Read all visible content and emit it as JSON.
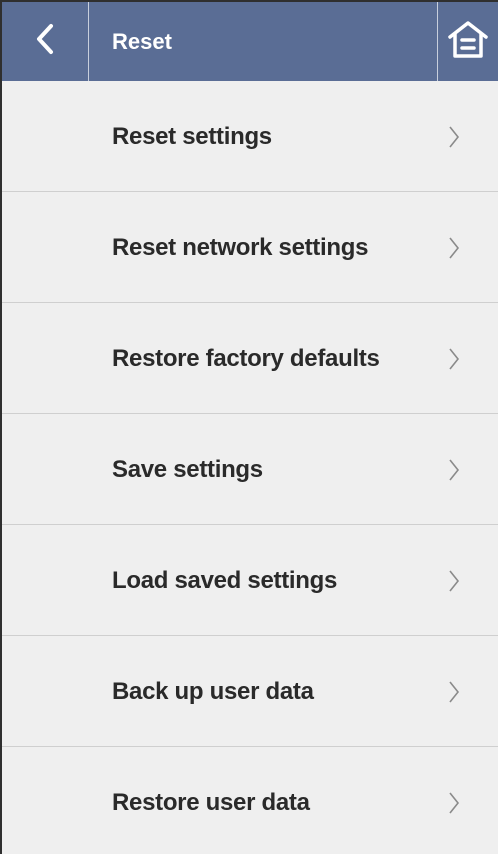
{
  "header": {
    "title": "Reset",
    "back_icon": "chevron-left-icon",
    "home_icon": "home-icon",
    "background_color": "#5a6d95"
  },
  "menu": {
    "items": [
      {
        "label": "Reset settings"
      },
      {
        "label": "Reset network settings"
      },
      {
        "label": "Restore factory defaults"
      },
      {
        "label": "Save settings"
      },
      {
        "label": "Load saved settings"
      },
      {
        "label": "Back up user data"
      },
      {
        "label": "Restore user data"
      }
    ],
    "item_icon": "chevron-right-icon"
  }
}
